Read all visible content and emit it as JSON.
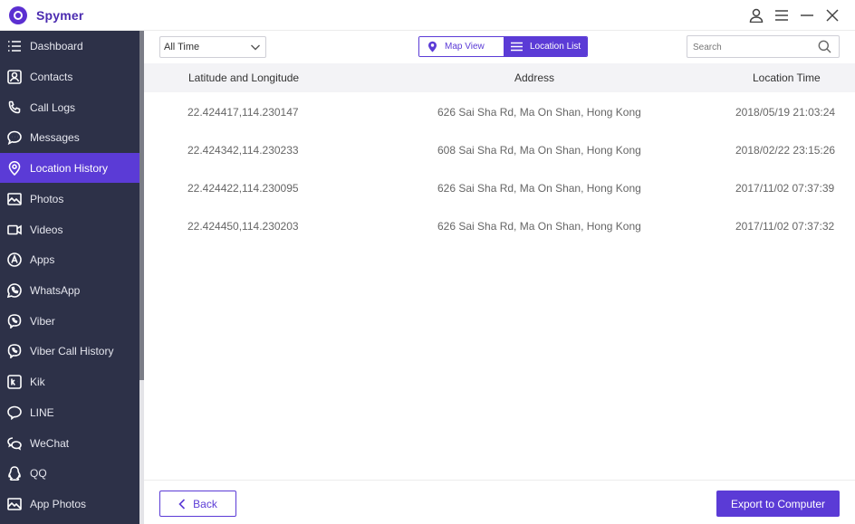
{
  "app": {
    "title": "Spymer",
    "brand_color": "#5b3bd6",
    "sidebar_color": "#2d3148"
  },
  "window_controls": [
    {
      "name": "account-icon"
    },
    {
      "name": "menu-icon"
    },
    {
      "name": "minimize-icon"
    },
    {
      "name": "close-icon"
    }
  ],
  "sidebar": {
    "items": [
      {
        "label": "Dashboard",
        "icon": "list-icon",
        "active": false
      },
      {
        "label": "Contacts",
        "icon": "contacts-icon",
        "active": false
      },
      {
        "label": "Call Logs",
        "icon": "phone-icon",
        "active": false
      },
      {
        "label": "Messages",
        "icon": "message-icon",
        "active": false
      },
      {
        "label": "Location History",
        "icon": "location-pin-icon",
        "active": true
      },
      {
        "label": "Photos",
        "icon": "photo-icon",
        "active": false
      },
      {
        "label": "Videos",
        "icon": "video-icon",
        "active": false
      },
      {
        "label": "Apps",
        "icon": "apps-icon",
        "active": false
      },
      {
        "label": "WhatsApp",
        "icon": "whatsapp-icon",
        "active": false
      },
      {
        "label": "Viber",
        "icon": "viber-icon",
        "active": false
      },
      {
        "label": "Viber Call History",
        "icon": "viber-call-icon",
        "active": false
      },
      {
        "label": "Kik",
        "icon": "kik-icon",
        "active": false
      },
      {
        "label": "LINE",
        "icon": "line-icon",
        "active": false
      },
      {
        "label": "WeChat",
        "icon": "wechat-icon",
        "active": false
      },
      {
        "label": "QQ",
        "icon": "qq-icon",
        "active": false
      },
      {
        "label": "App Photos",
        "icon": "app-photos-icon",
        "active": false
      }
    ]
  },
  "toolbar": {
    "time_filter": "All Time",
    "map_view_label": "Map View",
    "location_list_label": "Location List",
    "search_placeholder": "Search"
  },
  "table": {
    "columns": [
      "Latitude and Longitude",
      "Address",
      "Location Time"
    ],
    "rows": [
      [
        "22.424417,114.230147",
        "626 Sai Sha Rd, Ma On Shan, Hong Kong",
        "2018/05/19 21:03:24"
      ],
      [
        "22.424342,114.230233",
        "608 Sai Sha Rd, Ma On Shan, Hong Kong",
        "2018/02/22 23:15:26"
      ],
      [
        "22.424422,114.230095",
        "626 Sai Sha Rd, Ma On Shan, Hong Kong",
        "2017/11/02 07:37:39"
      ],
      [
        "22.424450,114.230203",
        "626 Sai Sha Rd, Ma On Shan, Hong Kong",
        "2017/11/02 07:37:32"
      ]
    ]
  },
  "footer": {
    "back_label": "Back",
    "export_label": "Export to Computer"
  }
}
